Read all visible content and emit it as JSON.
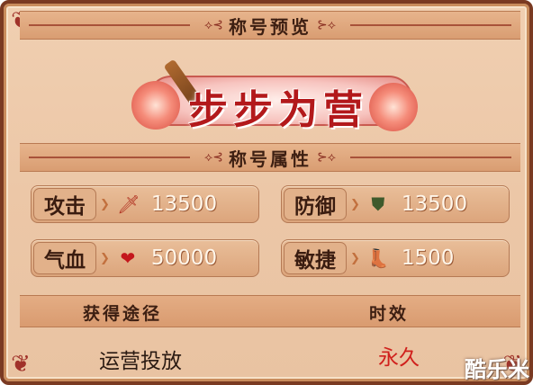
{
  "preview_section": {
    "title": "称号预览"
  },
  "title_banner": {
    "text": "步步为营"
  },
  "attributes_section": {
    "title": "称号属性"
  },
  "attributes": [
    {
      "name": "攻击",
      "icon": "sword-icon",
      "value": "13500"
    },
    {
      "name": "防御",
      "icon": "shield-icon",
      "value": "13500"
    },
    {
      "name": "气血",
      "icon": "heart-icon",
      "value": "50000"
    },
    {
      "name": "敏捷",
      "icon": "boot-icon",
      "value": "1500"
    }
  ],
  "info_table": {
    "headers": [
      "获得途径",
      "时效"
    ],
    "acquire_method": "运营投放",
    "duration": "永久"
  },
  "watermark": {
    "text": "酷乐米"
  },
  "colors": {
    "banner_text": "#b3191b",
    "duration_text": "#d0201c",
    "panel_bg": "#ecc7a7"
  }
}
